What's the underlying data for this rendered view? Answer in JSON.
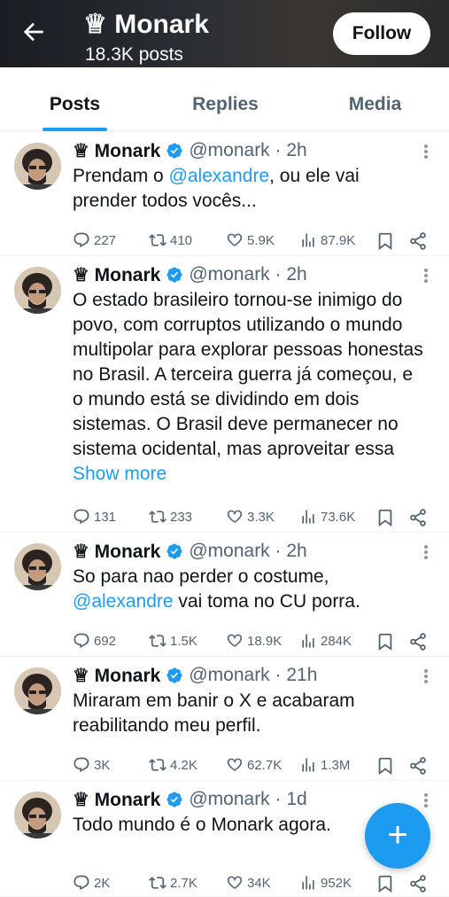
{
  "header": {
    "back_icon": "arrow-left-icon",
    "name": "♕ Monark",
    "posts_count": "18.3K posts",
    "follow_label": "Follow"
  },
  "tabs": [
    {
      "label": "Posts",
      "active": true
    },
    {
      "label": "Replies",
      "active": false
    },
    {
      "label": "Media",
      "active": false
    }
  ],
  "posts": [
    {
      "name": "♕ Monark",
      "handle": "@monark · 2h",
      "text": [
        {
          "t": "Prendam o "
        },
        {
          "t": "@alexandre",
          "m": true
        },
        {
          "t": ", ou ele vai prender todos vocês..."
        }
      ],
      "replies": "227",
      "reposts": "410",
      "likes": "5.9K",
      "views": "87.9K"
    },
    {
      "name": "♕ Monark",
      "handle": "@monark · 2h",
      "text": [
        {
          "t": "O estado brasileiro tornou-se inimigo do povo, com corruptos utilizando o mundo multipolar para explorar pessoas honestas no Brasil. A terceira guerra já começou, e o mundo está se dividindo em dois sistemas. O Brasil deve permanecer no sistema ocidental, mas aproveitar essa "
        },
        {
          "t": "Show more",
          "s": true
        }
      ],
      "replies": "131",
      "reposts": "233",
      "likes": "3.3K",
      "views": "73.6K"
    },
    {
      "name": "♕ Monark",
      "handle": "@monark · 2h",
      "text": [
        {
          "t": "So para nao perder o costume, "
        },
        {
          "t": "@alexandre",
          "m": true
        },
        {
          "t": " vai toma no CU porra."
        }
      ],
      "replies": "692",
      "reposts": "1.5K",
      "likes": "18.9K",
      "views": "284K"
    },
    {
      "name": "♕ Monark",
      "handle": "@monark · 21h",
      "text": [
        {
          "t": "Miraram em banir o X e acabaram reabilitando meu perfil."
        }
      ],
      "replies": "3K",
      "reposts": "4.2K",
      "likes": "62.7K",
      "views": "1.3M"
    },
    {
      "name": "♕ Monark",
      "handle": "@monark · 1d",
      "text": [
        {
          "t": "Todo mundo é o Monark agora."
        }
      ],
      "replies": "2K",
      "reposts": "2.7K",
      "likes": "34K",
      "views": "952K"
    }
  ],
  "fab": {
    "label": "+",
    "icon": "compose-plus-icon"
  },
  "colors": {
    "accent": "#1d9bf0",
    "text": "#0f1419",
    "muted": "#536471",
    "divider": "#eff3f4"
  }
}
